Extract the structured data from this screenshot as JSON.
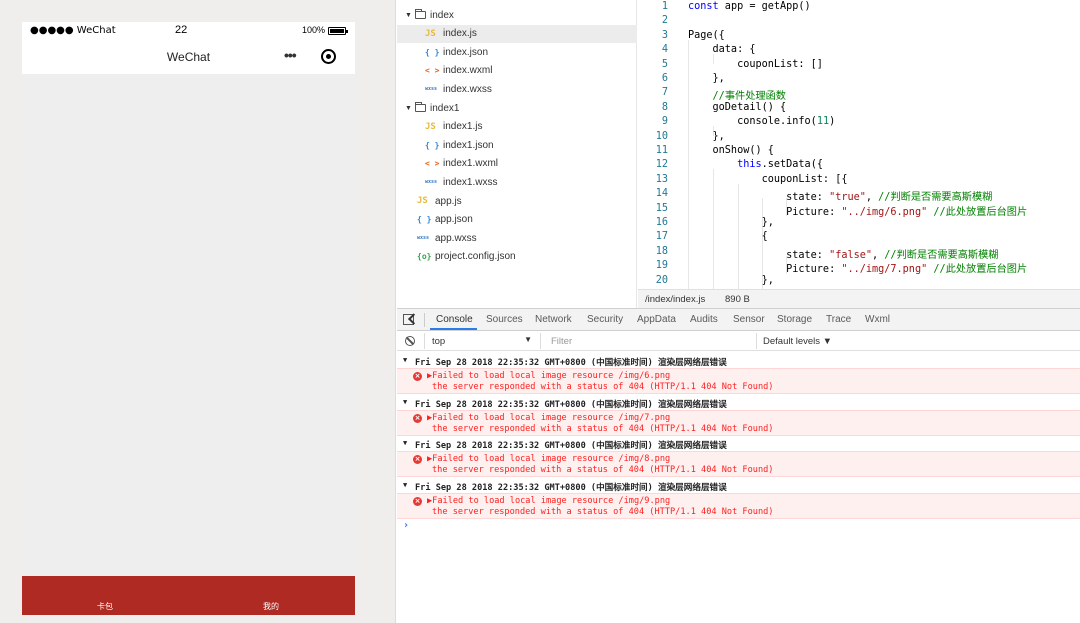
{
  "simulator": {
    "carrier": "●●●●● WeChat",
    "time": "22",
    "battery_pct": "100%",
    "nav_title": "WeChat",
    "more_icon": "•••",
    "tabs": [
      {
        "label": "卡包"
      },
      {
        "label": "我的"
      }
    ],
    "tabbar_color": "#ae2a22"
  },
  "file_tree": {
    "items": [
      {
        "label": "index",
        "icon": "folder-icon",
        "type": "folder",
        "glyph": ""
      },
      {
        "label": "index.js",
        "icon": "js-file-icon",
        "type": "js",
        "glyph": "JS"
      },
      {
        "label": "index.json",
        "icon": "json-file-icon",
        "type": "json",
        "glyph": "{ }"
      },
      {
        "label": "index.wxml",
        "icon": "wxml-file-icon",
        "type": "wxml",
        "glyph": "< >"
      },
      {
        "label": "index.wxss",
        "icon": "wxss-file-icon",
        "type": "wxss",
        "glyph": "wxss"
      },
      {
        "label": "index1",
        "icon": "folder-icon",
        "type": "folder",
        "glyph": ""
      },
      {
        "label": "index1.js",
        "icon": "js-file-icon",
        "type": "js",
        "glyph": "JS"
      },
      {
        "label": "index1.json",
        "icon": "json-file-icon",
        "type": "json",
        "glyph": "{ }"
      },
      {
        "label": "index1.wxml",
        "icon": "wxml-file-icon",
        "type": "wxml",
        "glyph": "< >"
      },
      {
        "label": "index1.wxss",
        "icon": "wxss-file-icon",
        "type": "wxss",
        "glyph": "wxss"
      },
      {
        "label": "app.js",
        "icon": "js-file-icon",
        "type": "js",
        "glyph": "JS"
      },
      {
        "label": "app.json",
        "icon": "json-file-icon",
        "type": "json",
        "glyph": "{ }"
      },
      {
        "label": "app.wxss",
        "icon": "wxss-file-icon",
        "type": "wxss",
        "glyph": "wxss"
      },
      {
        "label": "project.config.json",
        "icon": "config-file-icon",
        "type": "cfg",
        "glyph": "{o}"
      }
    ]
  },
  "editor": {
    "lines": [
      {
        "n": "1",
        "html": "<span class='tok-kw'>const</span> app = getApp()"
      },
      {
        "n": "2",
        "html": ""
      },
      {
        "n": "3",
        "html": "Page({"
      },
      {
        "n": "4",
        "html": "    data: {"
      },
      {
        "n": "5",
        "html": "        couponList: []"
      },
      {
        "n": "6",
        "html": "    },"
      },
      {
        "n": "7",
        "html": "    <span class='tok-cmt'>//事件处理函数</span>"
      },
      {
        "n": "8",
        "html": "    goDetail() {"
      },
      {
        "n": "9",
        "html": "        console.info(<span class='tok-num'>11</span>)"
      },
      {
        "n": "10",
        "html": "    },"
      },
      {
        "n": "11",
        "html": "    onShow() {"
      },
      {
        "n": "12",
        "html": "        <span class='tok-kw'>this</span>.setData({"
      },
      {
        "n": "13",
        "html": "            couponList: [{"
      },
      {
        "n": "14",
        "html": "                state: <span class='tok-str'>\"true\"</span>, <span class='tok-cmt'>//判断是否需要高斯模糊</span>"
      },
      {
        "n": "15",
        "html": "                Picture: <span class='tok-str'>\"../img/6.png\"</span> <span class='tok-cmt'>//此处放置后台图片</span>"
      },
      {
        "n": "16",
        "html": "            },"
      },
      {
        "n": "17",
        "html": "            {"
      },
      {
        "n": "18",
        "html": "                state: <span class='tok-str'>\"false\"</span>, <span class='tok-cmt'>//判断是否需要高斯模糊</span>"
      },
      {
        "n": "19",
        "html": "                Picture: <span class='tok-str'>\"../img/7.png\"</span> <span class='tok-cmt'>//此处放置后台图片</span>"
      },
      {
        "n": "20",
        "html": "            },"
      }
    ],
    "file_path": "/index/index.js",
    "file_size": "890 B"
  },
  "devtools": {
    "tabs": [
      "Console",
      "Sources",
      "Network",
      "Security",
      "AppData",
      "Audits",
      "Sensor",
      "Storage",
      "Trace",
      "Wxml"
    ],
    "active_tab": "Console",
    "context": "top",
    "filter_placeholder": "Filter",
    "levels_label": "Default levels ▼",
    "groups": [
      {
        "header": "Fri Sep 28 2018 22:35:32 GMT+0800 (中国标准时间) 渲染层网络层错误",
        "line1": "▶Failed to load local image resource /img/6.png",
        "line2": "the server responded with a status of 404 (HTTP/1.1 404 Not Found)"
      },
      {
        "header": "Fri Sep 28 2018 22:35:32 GMT+0800 (中国标准时间) 渲染层网络层错误",
        "line1": "▶Failed to load local image resource /img/7.png",
        "line2": "the server responded with a status of 404 (HTTP/1.1 404 Not Found)"
      },
      {
        "header": "Fri Sep 28 2018 22:35:32 GMT+0800 (中国标准时间) 渲染层网络层错误",
        "line1": "▶Failed to load local image resource /img/8.png",
        "line2": "the server responded with a status of 404 (HTTP/1.1 404 Not Found)"
      },
      {
        "header": "Fri Sep 28 2018 22:35:32 GMT+0800 (中国标准时间) 渲染层网络层错误",
        "line1": "▶Failed to load local image resource /img/9.png",
        "line2": "the server responded with a status of 404 (HTTP/1.1 404 Not Found)"
      }
    ],
    "prompt": "›"
  }
}
